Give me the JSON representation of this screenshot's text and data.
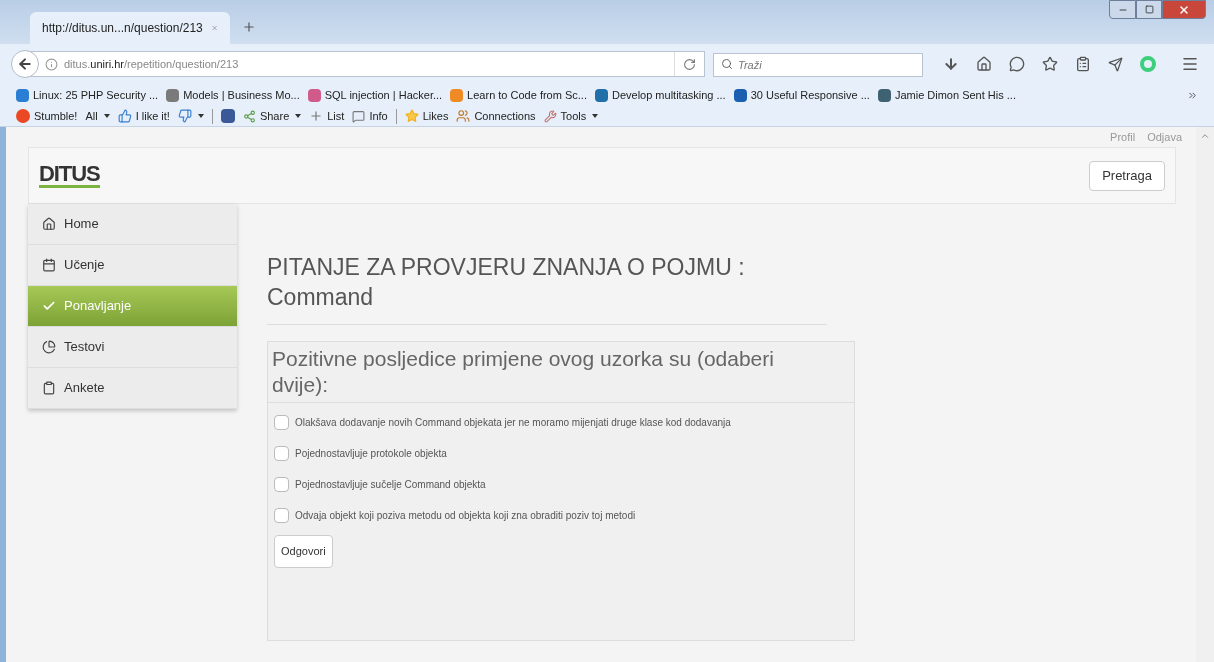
{
  "browser": {
    "tab": {
      "title": "http://ditus.un...n/question/213",
      "selected": true
    },
    "address": {
      "host_prefix": "ditus.",
      "host": "uniri.hr",
      "path": "/repetition/question/213"
    },
    "search": {
      "placeholder": "Traži"
    },
    "bookmarks": [
      {
        "label": "Linux: 25 PHP Security ...",
        "color": "#2a7fd4"
      },
      {
        "label": "Models | Business Mo...",
        "color": "#7a7a7a"
      },
      {
        "label": "SQL injection | Hacker...",
        "color": "#d05a8a"
      },
      {
        "label": "Learn to Code from Sc...",
        "color": "#f08a24"
      },
      {
        "label": "Develop multitasking ...",
        "color": "#1f6fa8"
      },
      {
        "label": "30 Useful Responsive ...",
        "color": "#1a5fb0"
      },
      {
        "label": "Jamie Dimon Sent His ...",
        "color": "#3f6272"
      }
    ],
    "addons": [
      {
        "kind": "stumble",
        "label": "Stumble!",
        "dropdown": false
      },
      {
        "kind": "plain",
        "label": "All",
        "dropdown": true
      },
      {
        "kind": "like",
        "label": "I like it!",
        "dropdown": false
      },
      {
        "kind": "dislike",
        "dropdown": true
      },
      {
        "kind": "facebook",
        "dropdown": false
      },
      {
        "kind": "share",
        "label": "Share",
        "dropdown": true
      },
      {
        "kind": "list",
        "label": "List",
        "dropdown": false
      },
      {
        "kind": "info",
        "label": "Info",
        "dropdown": false
      },
      {
        "kind": "likes",
        "label": "Likes",
        "dropdown": false
      },
      {
        "kind": "connections",
        "label": "Connections",
        "dropdown": false
      },
      {
        "kind": "tools",
        "label": "Tools",
        "dropdown": true
      }
    ]
  },
  "page": {
    "top_links": [
      "Profil",
      "Odjava"
    ],
    "logo": "DITUS",
    "search_button": "Pretraga",
    "sidebar": [
      {
        "kind": "home",
        "label": "Home",
        "selected": false
      },
      {
        "kind": "learning",
        "label": "Učenje",
        "selected": false
      },
      {
        "kind": "repeat",
        "label": "Ponavljanje",
        "selected": true
      },
      {
        "kind": "tests",
        "label": "Testovi",
        "selected": false
      },
      {
        "kind": "surveys",
        "label": "Ankete",
        "selected": false
      }
    ],
    "heading": "PITANJE ZA PROVJERU ZNANJA O POJMU : Command",
    "question": "Pozitivne posljedice primjene ovog uzorka su (odaberi dvije):",
    "options": [
      {
        "label": "Olakšava dodavanje novih Command objekata jer ne moramo mijenjati druge klase kod dodavanja",
        "checked": false
      },
      {
        "label": "Pojednostavljuje protokole objekta",
        "checked": false
      },
      {
        "label": "Pojednostavljuje sučelje Command objekta",
        "checked": false
      },
      {
        "label": "Odvaja objekt koji poziva metodu od objekta koji zna obraditi poziv toj metodi",
        "checked": false
      }
    ],
    "submit": "Odgovori"
  }
}
